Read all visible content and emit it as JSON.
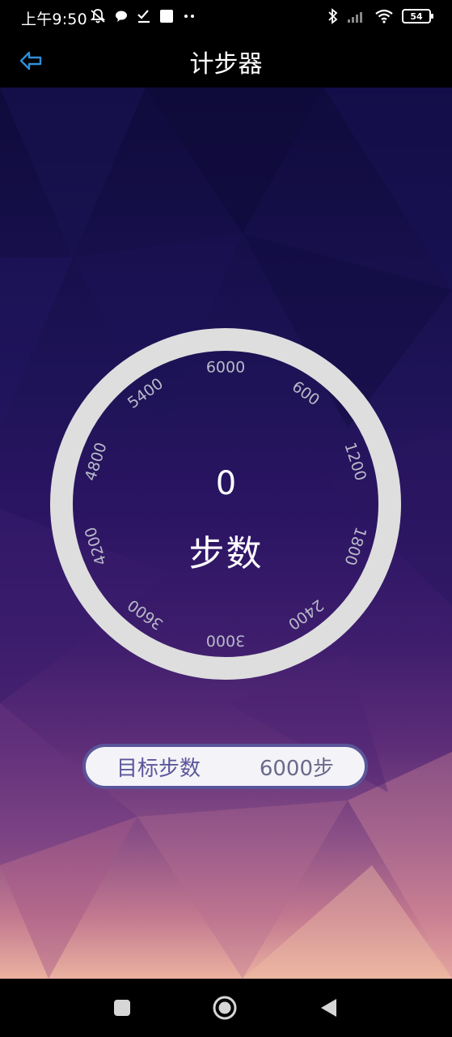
{
  "status_bar": {
    "time": "上午9:50",
    "battery": "54",
    "icons": [
      "mute-bell-icon",
      "chat-bubble-icon",
      "check-icon",
      "square-icon",
      "more-dots-icon",
      "bluetooth-icon",
      "signal-icon",
      "wifi-icon",
      "battery-icon"
    ]
  },
  "header": {
    "title": "计步器",
    "back_icon": "back-arrow-icon"
  },
  "dial": {
    "steps": "0",
    "unit": "步数",
    "ticks": [
      "6000",
      "600",
      "1200",
      "1800",
      "2400",
      "3000",
      "3600",
      "4200",
      "4800",
      "5400"
    ]
  },
  "goal": {
    "label": "目标步数",
    "value": "6000步"
  },
  "nav": {
    "icons": [
      "recent-apps-icon",
      "home-icon",
      "back-icon"
    ]
  },
  "colors": {
    "dial_ring": "#dedede",
    "goal_border": "#5a559a",
    "goal_text": "#5b579a",
    "back_icon": "#2f8fd8"
  }
}
